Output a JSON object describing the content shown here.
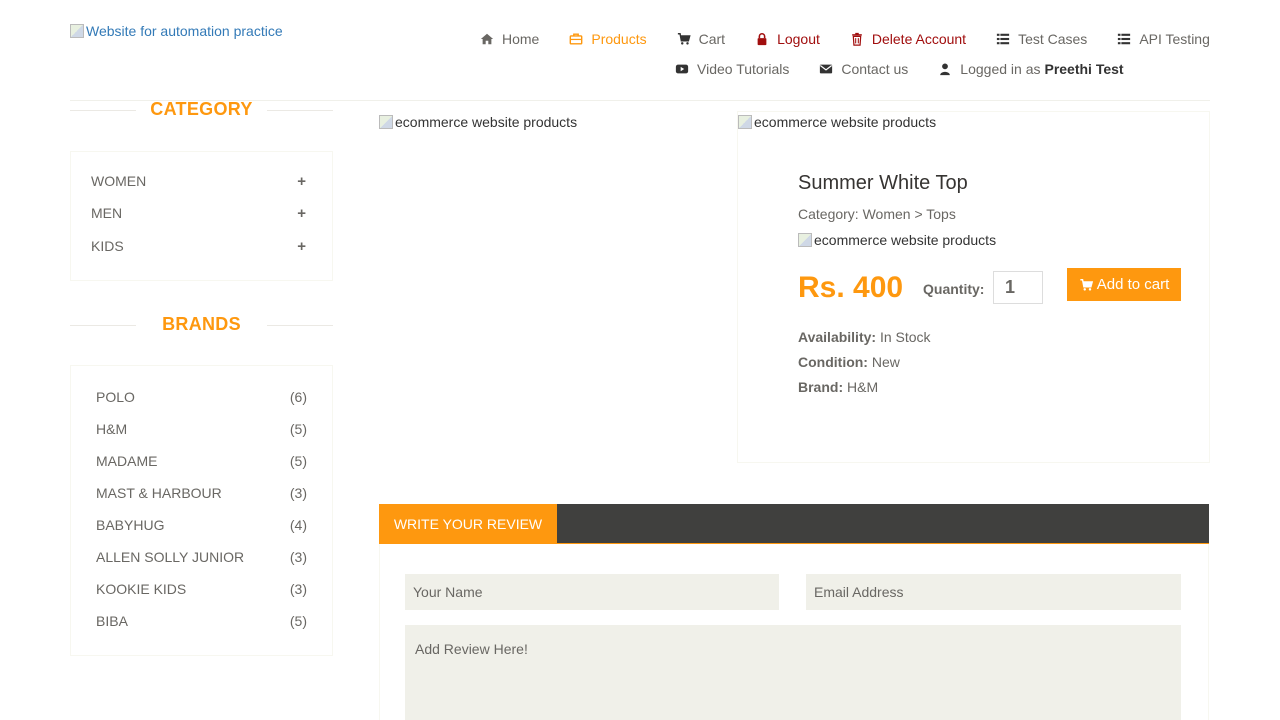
{
  "header": {
    "logo_alt": "Website for automation practice",
    "nav": {
      "home": "Home",
      "products": "Products",
      "cart": "Cart",
      "logout": "Logout",
      "delete_account": "Delete Account",
      "test_cases": "Test Cases",
      "api_testing": "API Testing",
      "video_tutorials": "Video Tutorials",
      "contact_us": "Contact us",
      "logged_in_prefix": "Logged in as",
      "username": "Preethi Test"
    }
  },
  "sidebar": {
    "category_title": "CATEGORY",
    "categories": [
      {
        "label": "WOMEN",
        "expand": "+"
      },
      {
        "label": "MEN",
        "expand": "+"
      },
      {
        "label": "KIDS",
        "expand": "+"
      }
    ],
    "brands_title": "BRANDS",
    "brands": [
      {
        "label": "POLO",
        "count": "(6)"
      },
      {
        "label": "H&M",
        "count": "(5)"
      },
      {
        "label": "MADAME",
        "count": "(5)"
      },
      {
        "label": "MAST & HARBOUR",
        "count": "(3)"
      },
      {
        "label": "BABYHUG",
        "count": "(4)"
      },
      {
        "label": "ALLEN SOLLY JUNIOR",
        "count": "(3)"
      },
      {
        "label": "KOOKIE KIDS",
        "count": "(3)"
      },
      {
        "label": "BIBA",
        "count": "(5)"
      }
    ]
  },
  "product": {
    "image_alt": "ecommerce website products",
    "name": "Summer White Top",
    "category": "Category: Women > Tops",
    "price": "Rs. 400",
    "quantity_label": "Quantity:",
    "quantity_value": "1",
    "add_to_cart": "Add to cart",
    "availability_label": "Availability:",
    "availability_value": "In Stock",
    "condition_label": "Condition:",
    "condition_value": "New",
    "brand_label": "Brand:",
    "brand_value": "H&M"
  },
  "review": {
    "tab_label": "WRITE YOUR REVIEW",
    "name_placeholder": "Your Name",
    "email_placeholder": "Email Address",
    "review_placeholder": "Add Review Here!"
  },
  "colors": {
    "accent": "#FE980F",
    "dark_bar": "#40403e",
    "danger": "#a10e0e",
    "field_bg": "#F0F0E9"
  },
  "icons": [
    "home-icon",
    "briefcase-icon",
    "cart-icon",
    "lock-icon",
    "trash-icon",
    "list-icon",
    "youtube-icon",
    "envelope-icon",
    "user-icon"
  ]
}
